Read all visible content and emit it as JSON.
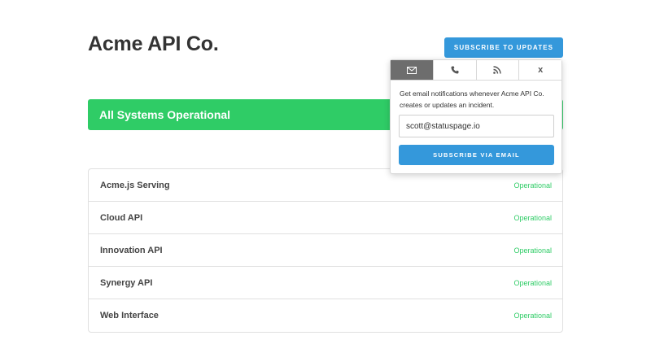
{
  "header": {
    "company_name": "Acme API Co.",
    "subscribe_button": "SUBSCRIBE TO UPDATES"
  },
  "status_banner": {
    "text": "All Systems Operational",
    "color": "#2fcc66"
  },
  "components": [
    {
      "name": "Acme.js Serving",
      "status": "Operational"
    },
    {
      "name": "Cloud API",
      "status": "Operational"
    },
    {
      "name": "Innovation API",
      "status": "Operational"
    },
    {
      "name": "Synergy API",
      "status": "Operational"
    },
    {
      "name": "Web Interface",
      "status": "Operational"
    }
  ],
  "subscribe_popup": {
    "tabs": [
      {
        "icon": "envelope-icon",
        "active": true
      },
      {
        "icon": "phone-icon",
        "active": false
      },
      {
        "icon": "rss-icon",
        "active": false
      },
      {
        "icon": "close-icon",
        "label": "x",
        "active": false
      }
    ],
    "description": "Get email notifications whenever Acme API Co. creates or updates an incident.",
    "email_value": "scott@statuspage.io",
    "submit_label": "SUBSCRIBE VIA EMAIL"
  },
  "colors": {
    "accent_blue": "#3498db",
    "operational_green": "#2fcc66",
    "active_tab": "#6d6d6d"
  }
}
